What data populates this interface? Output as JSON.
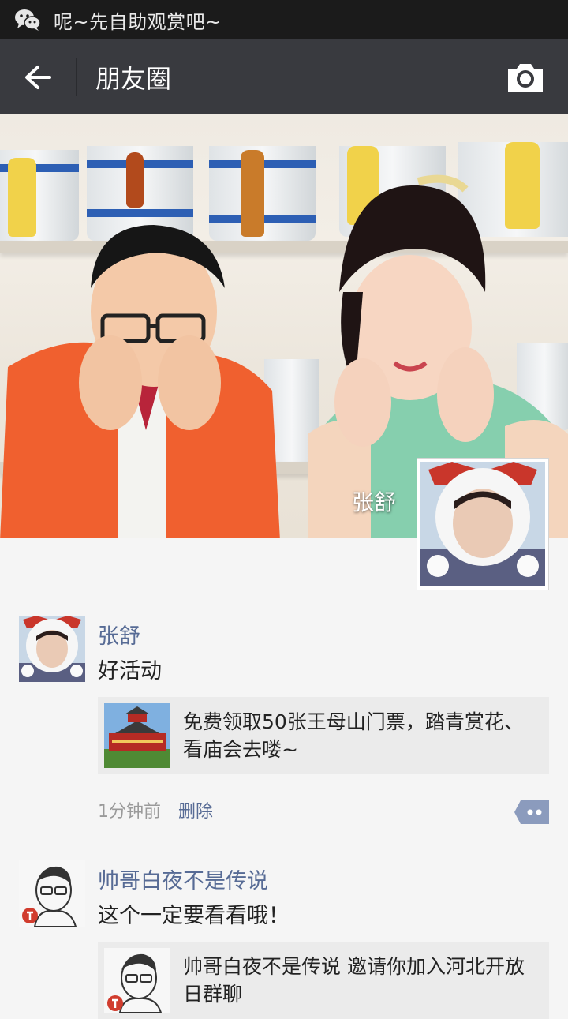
{
  "statusbar": {
    "app_icon": "wechat-icon",
    "message": "呢~先自助观赏吧~"
  },
  "appbar": {
    "back_icon": "arrow-left-icon",
    "title": "朋友圈",
    "camera_icon": "camera-icon"
  },
  "cover": {
    "owner_name": "张舒"
  },
  "posts": [
    {
      "author": "张舒",
      "text": "好活动",
      "share_text": "免费领取50张王母山门票，踏青赏花、看庙会去喽~",
      "time": "1分钟前",
      "delete_label": "删除",
      "comment_icon": "comment-icon"
    },
    {
      "author": "帅哥白夜不是传说",
      "text": "这个一定要看看哦！",
      "share_text": "帅哥白夜不是传说 邀请你加入河北开放日群聊"
    }
  ],
  "colors": {
    "statusbar_bg": "#1b1b1b",
    "appbar_bg": "#393a3f",
    "link": "#576b95",
    "page_bg": "#f5f5f5",
    "card_bg": "#ebebeb"
  }
}
